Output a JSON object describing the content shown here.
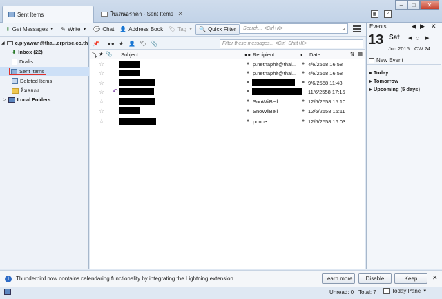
{
  "tabs": [
    {
      "label": "Sent Items"
    },
    {
      "label": "ใบเสนอราคา - Sent Items"
    }
  ],
  "toolbar": {
    "get_messages": "Get Messages",
    "write": "Write",
    "chat": "Chat",
    "address_book": "Address Book",
    "tag": "Tag",
    "quick_filter": "Quick Filter",
    "search_placeholder": "Search... <Ctrl+K>"
  },
  "folders": {
    "account": "c.piyawan@tha...erprise.co.th",
    "items": [
      {
        "label": "Inbox (22)",
        "bold": true
      },
      {
        "label": "Drafts"
      },
      {
        "label": "Sent Items"
      },
      {
        "label": "Deleted Items"
      },
      {
        "label": "ลิ่มสยอง"
      }
    ],
    "local": "Local Folders"
  },
  "filter": {
    "placeholder": "Filter these messages... <Ctrl+Shift+K>"
  },
  "columns": {
    "subject": "Subject",
    "recipient": "Recipient",
    "date": "Date"
  },
  "messages": [
    {
      "recipient": "p.netnaphit@thai...",
      "date": "4/6/2558 16:58"
    },
    {
      "recipient": "p.netnaphit@thai...",
      "date": "4/6/2558 16:58"
    },
    {
      "recipient": "",
      "date": "9/6/2558 11:48"
    },
    {
      "recipient": "",
      "date": "11/6/2558 17:15"
    },
    {
      "recipient": "SnoWiiBell",
      "date": "12/6/2558 15:10"
    },
    {
      "recipient": "SnoWiiBell",
      "date": "12/6/2558 15:11"
    },
    {
      "recipient": "prince",
      "date": "12/6/2558 16:03"
    }
  ],
  "calendar": {
    "title": "Events",
    "day": "13",
    "weekday": "Sat",
    "month_year": "Jun 2015",
    "week": "CW 24",
    "new_event": "New Event",
    "groups": [
      "Today",
      "Tomorrow",
      "Upcoming (5 days)"
    ]
  },
  "notification": {
    "text": "Thunderbird now contains calendaring functionality by integrating the Lightning extension.",
    "learn_more": "Learn more",
    "disable": "Disable",
    "keep": "Keep"
  },
  "status": {
    "unread": "Unread: 0",
    "total": "Total: 7",
    "today_pane": "Today Pane"
  }
}
